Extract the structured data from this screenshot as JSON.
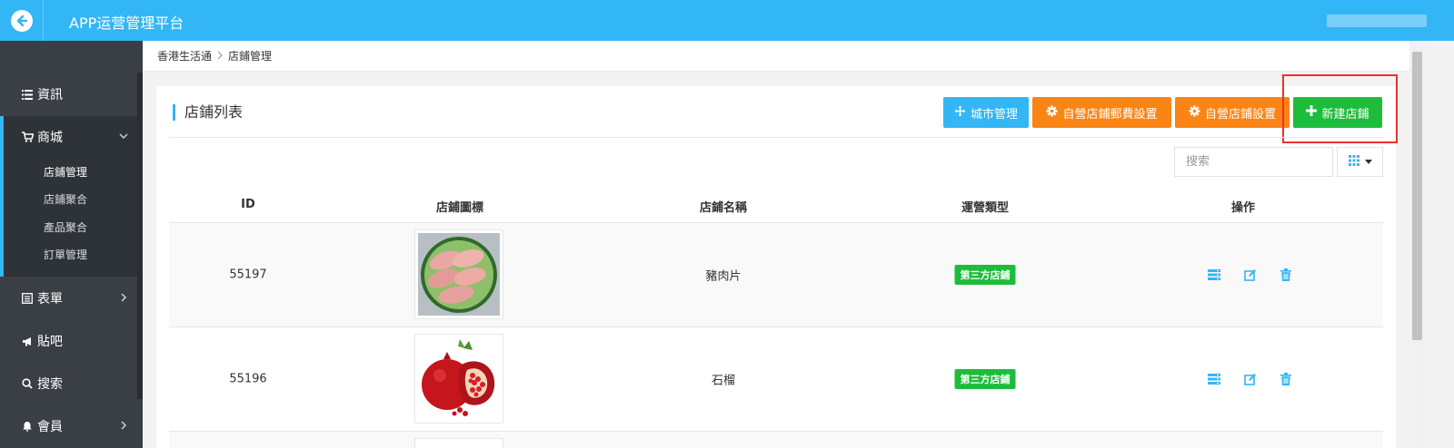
{
  "header": {
    "title": "APP运营管理平台"
  },
  "sidebar": {
    "items": [
      {
        "label": "資訊"
      },
      {
        "label": "商城"
      },
      {
        "label": "表單"
      },
      {
        "label": "貼吧"
      },
      {
        "label": "搜索"
      },
      {
        "label": "會員"
      }
    ],
    "sub_items": [
      {
        "label": "店鋪管理"
      },
      {
        "label": "店鋪聚合"
      },
      {
        "label": "產品聚合"
      },
      {
        "label": "訂單管理"
      }
    ]
  },
  "breadcrumb": {
    "home": "香港生活通",
    "current": "店鋪管理"
  },
  "card": {
    "title": "店鋪列表",
    "buttons": {
      "city": "城市管理",
      "shipping": "自營店鋪郵費設置",
      "settings": "自營店鋪設置",
      "new_store": "新建店鋪"
    }
  },
  "search": {
    "placeholder": "搜索"
  },
  "table": {
    "headers": {
      "id": "ID",
      "icon": "店鋪圖標",
      "name": "店鋪名稱",
      "type": "運營類型",
      "actions": "操作"
    },
    "rows": [
      {
        "id": "55197",
        "icon": "pork-slices-image",
        "name": "豬肉片",
        "type": "第三方店鋪"
      },
      {
        "id": "55196",
        "icon": "pomegranate-image",
        "name": "石榴",
        "type": "第三方店鋪"
      }
    ]
  },
  "colors": {
    "primary": "#33b6f5",
    "orange": "#fb8514",
    "green": "#1dbd3b",
    "sidebar": "#3a3f45",
    "highlight": "#e8312f"
  }
}
